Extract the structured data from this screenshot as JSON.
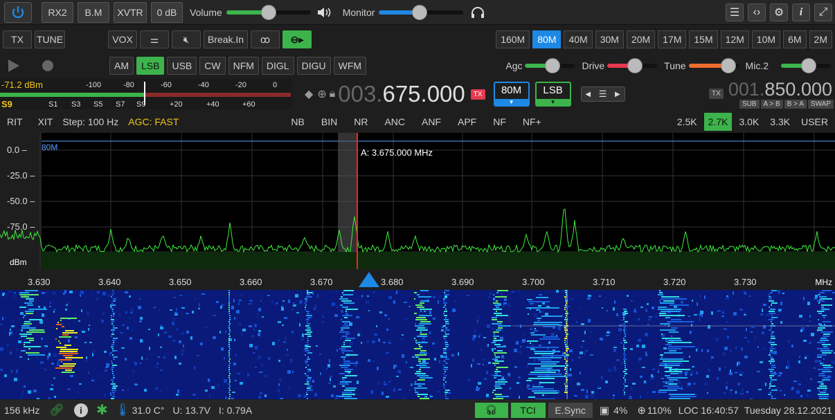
{
  "topbar": {
    "rx2": "RX2",
    "bm": "B.M",
    "xvtr": "XVTR",
    "db": "0 dB",
    "volume_label": "Volume",
    "volume_level": 0.5,
    "monitor_label": "Monitor",
    "monitor_level": 0.48
  },
  "modebar": {
    "tx": "TX",
    "tune": "TUNE",
    "vox": "VOX",
    "breakin": "Break.In",
    "bands": [
      "160M",
      "80M",
      "40M",
      "30M",
      "20M",
      "17M",
      "15M",
      "12M",
      "10M",
      "6M",
      "2M"
    ],
    "active_band": "80M"
  },
  "demod": {
    "modes": [
      "AM",
      "LSB",
      "USB",
      "CW",
      "NFM",
      "DIGL",
      "DIGU",
      "WFM"
    ],
    "active_mode": "LSB",
    "agc_label": "Agc",
    "drive_label": "Drive",
    "tune_label": "Tune",
    "mic_label": "Mic.2",
    "agc_level": 0.55,
    "drive_level": 0.55,
    "tune_level": 0.8,
    "mic_level": 0.55
  },
  "smeter": {
    "dbm": "-71.2 dBm",
    "s": "S9",
    "top_scale": [
      "-100",
      "-80",
      "-60",
      "-40",
      "-20",
      "0"
    ],
    "bottom_scale": [
      "S1",
      "S3",
      "S5",
      "S7",
      "S9",
      "+20",
      "+40",
      "+60"
    ]
  },
  "vfoa": {
    "freq_dim": "003.",
    "freq_main": "675.000",
    "tx_badge": "TX",
    "band": "80M",
    "mode": "LSB"
  },
  "vfob": {
    "tx_badge": "TX",
    "freq_dim": "001.",
    "freq_main": "850.000",
    "sub": "SUB",
    "atob": "A > B",
    "btoa": "B > A",
    "swap": "SWAP"
  },
  "dsp": {
    "rit": "RIT",
    "xit": "XIT",
    "step": "Step: 100 Hz",
    "agc": "AGC: FAST",
    "filters": [
      "NB",
      "BIN",
      "NR",
      "ANC",
      "ANF",
      "APF",
      "NF",
      "NF+"
    ],
    "bandwidths": [
      "2.5K",
      "2.7K",
      "3.0K",
      "3.3K",
      "USER"
    ],
    "active_bw": "2.7K"
  },
  "spectrum": {
    "band_label": "80M",
    "marker": "A: 3.675.000 MHz",
    "db_ticks": [
      "0.0",
      "-25.0",
      "-50.0",
      "-75.0"
    ],
    "unit": "dBm",
    "freq_ticks": [
      "3.630",
      "3.640",
      "3.650",
      "3.660",
      "3.670",
      "3.680",
      "3.690",
      "3.700",
      "3.710",
      "3.720",
      "3.730"
    ],
    "freq_unit": "MHz"
  },
  "status": {
    "span": "156 kHz",
    "temp": "31.0 C°",
    "voltage": "U: 13.7V",
    "current": "I: 0.79A",
    "tci": "TCI",
    "esync": "E.Sync",
    "cpu": "4%",
    "zoom": "110%",
    "clock": "LOC 16:40:57",
    "date": "Tuesday 28.12.2021"
  },
  "colors": {
    "accent_blue": "#1e88e5",
    "active_green": "#3cb44b",
    "spectrum_line": "#3cf03c",
    "marker_red": "#ff2020"
  }
}
